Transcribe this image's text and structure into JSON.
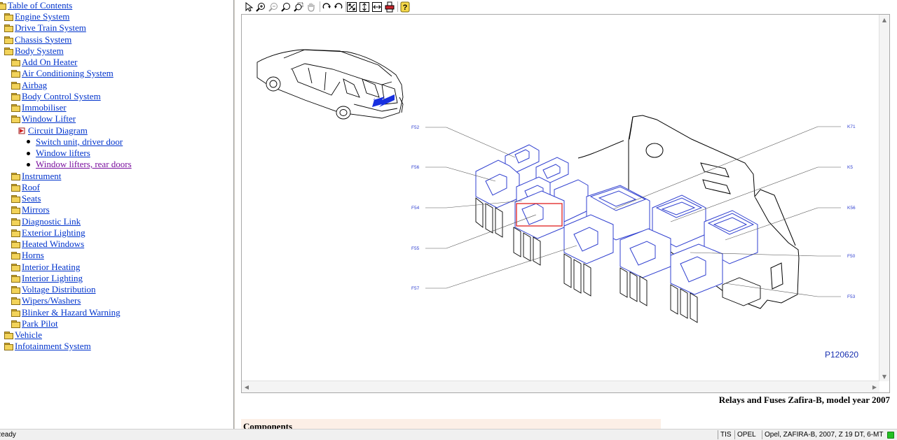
{
  "tree": {
    "root": "Table of Contents",
    "items": [
      {
        "label": "Engine System",
        "kind": "folder",
        "level": 1
      },
      {
        "label": "Drive Train System",
        "kind": "folder",
        "level": 1
      },
      {
        "label": "Chassis System",
        "kind": "folder",
        "level": 1
      },
      {
        "label": "Body System",
        "kind": "folder",
        "level": 1
      },
      {
        "label": "Add On Heater",
        "kind": "folder",
        "level": 2
      },
      {
        "label": "Air Conditioning System",
        "kind": "folder",
        "level": 2
      },
      {
        "label": "Airbag",
        "kind": "folder",
        "level": 2
      },
      {
        "label": "Body Control System",
        "kind": "folder",
        "level": 2
      },
      {
        "label": "Immobiliser",
        "kind": "folder",
        "level": 2
      },
      {
        "label": "Window Lifter",
        "kind": "folder",
        "level": 2
      },
      {
        "label": "Circuit Diagram",
        "kind": "diagram",
        "level": 3
      },
      {
        "label": "Switch unit, driver door",
        "kind": "leaf",
        "level": 4
      },
      {
        "label": "Window lifters",
        "kind": "leaf",
        "level": 4
      },
      {
        "label": "Window lifters, rear doors",
        "kind": "leaf",
        "level": 4,
        "visited": true
      },
      {
        "label": "Instrument",
        "kind": "folder",
        "level": 2
      },
      {
        "label": "Roof",
        "kind": "folder",
        "level": 2
      },
      {
        "label": "Seats",
        "kind": "folder",
        "level": 2
      },
      {
        "label": "Mirrors",
        "kind": "folder",
        "level": 2
      },
      {
        "label": "Diagnostic Link",
        "kind": "folder",
        "level": 2
      },
      {
        "label": "Exterior Lighting",
        "kind": "folder",
        "level": 2
      },
      {
        "label": "Heated Windows",
        "kind": "folder",
        "level": 2
      },
      {
        "label": "Horns",
        "kind": "folder",
        "level": 2
      },
      {
        "label": "Interior Heating",
        "kind": "folder",
        "level": 2
      },
      {
        "label": "Interior Lighting",
        "kind": "folder",
        "level": 2
      },
      {
        "label": "Voltage Distribution",
        "kind": "folder",
        "level": 2
      },
      {
        "label": "Wipers/Washers",
        "kind": "folder",
        "level": 2
      },
      {
        "label": "Blinker & Hazard Warning",
        "kind": "folder",
        "level": 2
      },
      {
        "label": "Park Pilot",
        "kind": "folder",
        "level": 2
      },
      {
        "label": "Vehicle",
        "kind": "folder",
        "level": 1
      },
      {
        "label": "Infotainment System",
        "kind": "folder",
        "level": 1
      }
    ]
  },
  "toolbar": {
    "tools": [
      "select-arrow-icon",
      "zoom-in-icon",
      "zoom-out-icon",
      "zoom-icon",
      "zoom-area-icon",
      "pan-hand-icon",
      "rotate-cw-icon",
      "rotate-ccw-icon",
      "fit-window-icon",
      "fit-height-icon",
      "fit-width-icon",
      "print-icon",
      "help-icon"
    ]
  },
  "diagram": {
    "labels_left": [
      "F52",
      "F56",
      "F54",
      "F55",
      "F57"
    ],
    "labels_right": [
      "K71",
      "K5",
      "K56",
      "F50",
      "F53"
    ],
    "ref": "P120620",
    "highlight_color": "#e02020",
    "part_color": "#3040d0"
  },
  "caption": "Relays and Fuses Zafira-B, model year 2007",
  "section": "Components",
  "status": {
    "text": "Ready",
    "app": "TIS",
    "make": "OPEL",
    "vehicle": "Opel, ZAFIRA-B, 2007, Z 19 DT, 6-MT",
    "led_color": "#24c024"
  }
}
